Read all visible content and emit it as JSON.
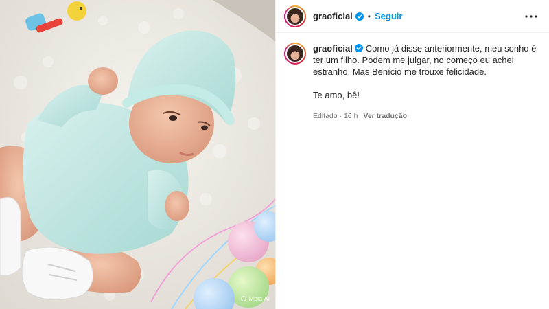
{
  "header": {
    "username": "graoficial",
    "separator": "•",
    "follow_label": "Seguir",
    "more_icon": "more-options-icon"
  },
  "caption": {
    "username": "graoficial",
    "text": "Como já disse anteriormente, meu sonho é ter um filho. Podem me julgar, no começo eu achei estranho. Mas Benício me trouxe felicidade.",
    "text2": "Te amo, bê!",
    "edited": "Editado",
    "dot": "·",
    "time": "16 h",
    "translate": "Ver tradução"
  },
  "media": {
    "watermark": "Meta AI"
  },
  "colors": {
    "accent": "#0095f6",
    "verified": "#0095f6",
    "muted": "#737373"
  }
}
